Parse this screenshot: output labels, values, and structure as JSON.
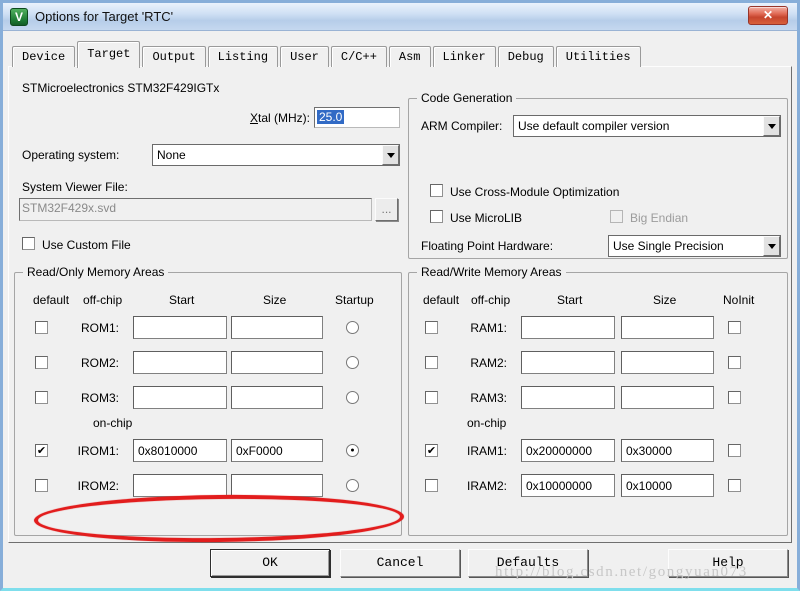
{
  "window": {
    "title": "Options for Target 'RTC'",
    "icon_glyph": "V",
    "close_glyph": "✕"
  },
  "tabs": [
    {
      "label": "Device"
    },
    {
      "label": "Target",
      "active": true
    },
    {
      "label": "Output"
    },
    {
      "label": "Listing"
    },
    {
      "label": "User"
    },
    {
      "label": "C/C++"
    },
    {
      "label": "Asm"
    },
    {
      "label": "Linker"
    },
    {
      "label": "Debug"
    },
    {
      "label": "Utilities"
    }
  ],
  "target_page": {
    "device_name": "STMicroelectronics STM32F429IGTx",
    "xtal_label": "Xtal (MHz):",
    "xtal_value": "25.0",
    "os_label": "Operating system:",
    "os_value": "None",
    "svf_label": "System Viewer File:",
    "svf_value": "STM32F429x.svd",
    "browse_label": "...",
    "use_custom_file_label": "Use Custom File"
  },
  "code_generation": {
    "title": "Code Generation",
    "arm_compiler_label": "ARM Compiler:",
    "arm_compiler_value": "Use default compiler version",
    "cross_module_label": "Use Cross-Module Optimization",
    "cross_module_checked": false,
    "microlib_label": "Use MicroLIB",
    "microlib_checked": false,
    "big_endian_label": "Big Endian",
    "big_endian_enabled": false,
    "fph_label": "Floating Point Hardware:",
    "fph_value": "Use Single Precision"
  },
  "read_only": {
    "title": "Read/Only Memory Areas",
    "headers": [
      "default",
      "off-chip",
      "Start",
      "Size",
      "Startup"
    ],
    "on_chip_label": "on-chip",
    "rows": [
      {
        "label": "ROM1:",
        "default_checked": false,
        "default_mark": "",
        "start": "",
        "size": "",
        "startup_selected": false,
        "startup_mark": ""
      },
      {
        "label": "ROM2:",
        "default_checked": false,
        "default_mark": "",
        "start": "",
        "size": "",
        "startup_selected": false,
        "startup_mark": ""
      },
      {
        "label": "ROM3:",
        "default_checked": false,
        "default_mark": "",
        "start": "",
        "size": "",
        "startup_selected": false,
        "startup_mark": ""
      },
      {
        "label": "IROM1:",
        "default_checked": true,
        "default_mark": "✔",
        "start": "0x8010000",
        "size": "0xF0000",
        "startup_selected": true,
        "startup_mark": "●"
      },
      {
        "label": "IROM2:",
        "default_checked": false,
        "default_mark": "",
        "start": "",
        "size": "",
        "startup_selected": false,
        "startup_mark": ""
      }
    ]
  },
  "read_write": {
    "title": "Read/Write Memory Areas",
    "headers": [
      "default",
      "off-chip",
      "Start",
      "Size",
      "NoInit"
    ],
    "on_chip_label": "on-chip",
    "rows": [
      {
        "label": "RAM1:",
        "default_checked": false,
        "default_mark": "",
        "start": "",
        "size": "",
        "noinit_checked": false,
        "noinit_mark": ""
      },
      {
        "label": "RAM2:",
        "default_checked": false,
        "default_mark": "",
        "start": "",
        "size": "",
        "noinit_checked": false,
        "noinit_mark": ""
      },
      {
        "label": "RAM3:",
        "default_checked": false,
        "default_mark": "",
        "start": "",
        "size": "",
        "noinit_checked": false,
        "noinit_mark": ""
      },
      {
        "label": "IRAM1:",
        "default_checked": true,
        "default_mark": "✔",
        "start": "0x20000000",
        "size": "0x30000",
        "noinit_checked": false,
        "noinit_mark": ""
      },
      {
        "label": "IRAM2:",
        "default_checked": false,
        "default_mark": "",
        "start": "0x10000000",
        "size": "0x10000",
        "noinit_checked": false,
        "noinit_mark": ""
      }
    ]
  },
  "buttons": {
    "ok": "OK",
    "cancel": "Cancel",
    "defaults": "Defaults",
    "help": "Help"
  },
  "watermark": "http://blog.csdn.net/gongyuan073",
  "colors": {
    "annotation_red": "#e21d1d",
    "selection_blue": "#316ac5",
    "titlebar_blue": "#c5d8ef",
    "close_red": "#c6452e"
  }
}
